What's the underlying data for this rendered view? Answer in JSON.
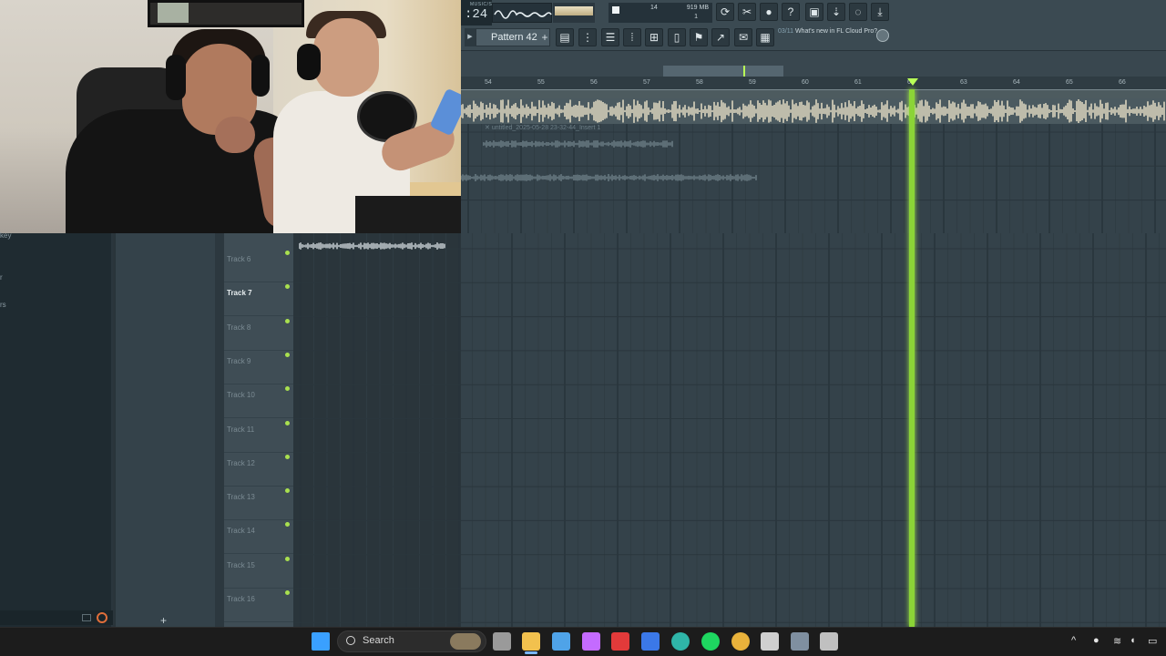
{
  "toolbar": {
    "time_label": "MUSIC/S",
    "time_value": ":24",
    "memory_number": "14",
    "memory_mb": "919 MB",
    "cpu_value": "1",
    "pattern_label": "Pattern 42",
    "pattern_add": "+",
    "news_count": "03/11",
    "news_text": "What's new in FL Cloud Pro?",
    "icons": [
      "loop-icon",
      "cut-icon",
      "mic-icon",
      "help-icon",
      "save-icon",
      "render-icon",
      "chat-icon",
      "download-icon",
      "playlist-icon",
      "mixer-icon",
      "channel-rack-icon",
      "piano-roll-icon",
      "browser-icon",
      "plugin-icon",
      "touch-icon",
      "cut2-icon",
      "shop-icon"
    ]
  },
  "timeline": {
    "bars": [
      "54",
      "55",
      "56",
      "57",
      "58",
      "59",
      "60",
      "61",
      "62",
      "63",
      "64",
      "65",
      "66"
    ]
  },
  "playlist": {
    "clip_name": "untitled_2025-05-28 23-32-44_Insert 1",
    "tracks": [
      {
        "name": "Track 6",
        "active": false
      },
      {
        "name": "Track 7",
        "active": true
      },
      {
        "name": "Track 8",
        "active": false
      },
      {
        "name": "Track 9",
        "active": false
      },
      {
        "name": "Track 10",
        "active": false
      },
      {
        "name": "Track 11",
        "active": false
      },
      {
        "name": "Track 12",
        "active": false
      },
      {
        "name": "Track 13",
        "active": false
      },
      {
        "name": "Track 14",
        "active": false
      },
      {
        "name": "Track 15",
        "active": false
      },
      {
        "name": "Track 16",
        "active": false
      }
    ],
    "add_track": "+"
  },
  "browser": {
    "row_key": "key",
    "row_1": "r",
    "row_2": "rs"
  },
  "taskbar": {
    "search_label": "Search",
    "apps": [
      "windows-start-icon",
      "task-view-icon",
      "file-explorer-icon",
      "store-icon",
      "copilot-icon",
      "l-app-icon",
      "vector-app-icon",
      "edge-icon",
      "spotify-icon",
      "chrome-icon",
      "screen-app-icon",
      "fl-studio-icon",
      "settings-icon"
    ]
  },
  "colors": {
    "playhead": "#8bd437",
    "panel": "#34424a",
    "taskbar": "#1c1c1c"
  }
}
